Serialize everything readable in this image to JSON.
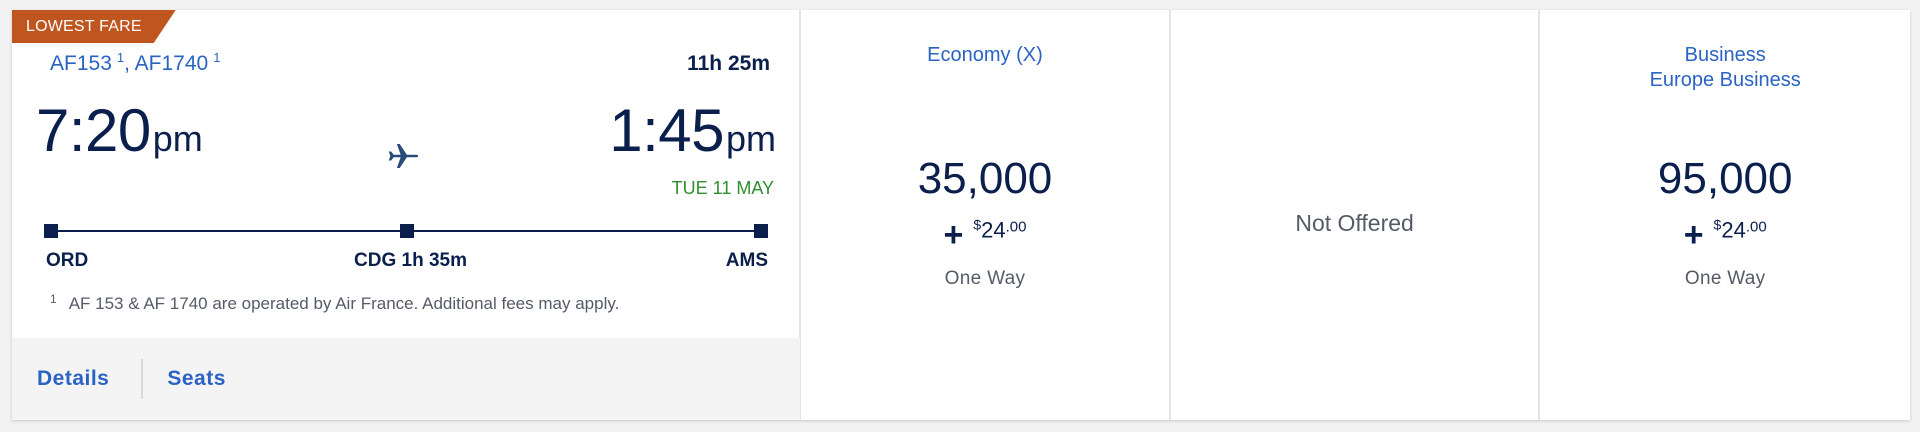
{
  "badge": "LOWEST FARE",
  "flight": {
    "numbers": [
      {
        "code": "AF153",
        "note": "1"
      },
      {
        "code": "AF1740",
        "note": "1"
      }
    ],
    "duration": "11h 25m",
    "departure": {
      "time": "7:20",
      "ampm": "pm",
      "airport": "ORD"
    },
    "arrival": {
      "time": "1:45",
      "ampm": "pm",
      "date": "TUE 11 MAY",
      "airport": "AMS"
    },
    "connection": "CDG 1h 35m",
    "footnote": {
      "mark": "1",
      "text": "AF 153 & AF 1740 are operated by Air France. Additional fees may apply."
    },
    "actions": {
      "details": "Details",
      "seats": "Seats"
    }
  },
  "fares": {
    "economy": {
      "cabin": "Economy (X)",
      "miles": "35,000",
      "plus": "+",
      "currency": "$",
      "fee_dollars": "24",
      "fee_cents": ".00",
      "trip": "One Way"
    },
    "middle": {
      "status": "Not Offered"
    },
    "business": {
      "cabin_line1": "Business",
      "cabin_line2": "Europe Business",
      "miles": "95,000",
      "plus": "+",
      "currency": "$",
      "fee_dollars": "24",
      "fee_cents": ".00",
      "trip": "One Way"
    }
  },
  "colors": {
    "badge": "#c0561f",
    "navy": "#0b1f4d",
    "link": "#2a63c4",
    "date_green": "#2f8f2f"
  },
  "icons": {
    "plane": "airplane-icon"
  }
}
